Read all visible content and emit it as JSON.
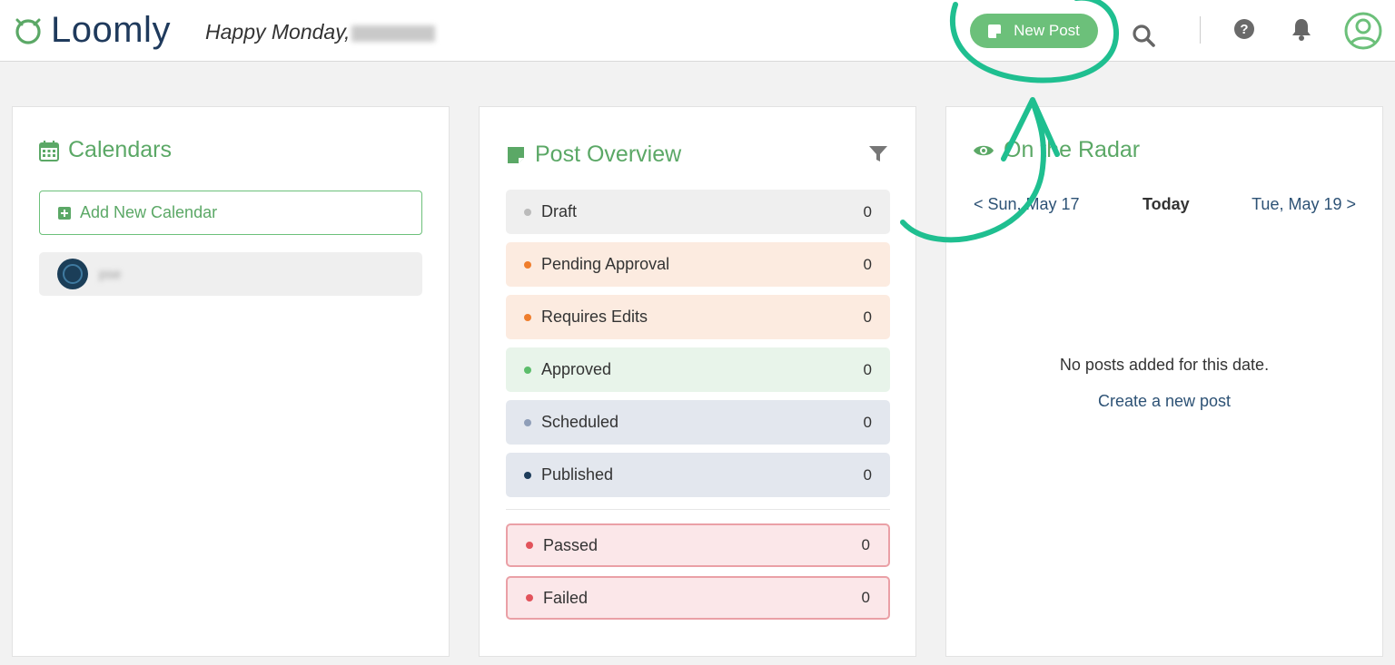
{
  "header": {
    "logo_text": "Loomly",
    "greeting": "Happy Monday",
    "greeting_suffix": ",",
    "new_post_label": "New Post",
    "help_label": "?"
  },
  "calendars": {
    "title": "Calendars",
    "add_label": "Add New Calendar",
    "items": [
      {
        "name": "pse"
      }
    ]
  },
  "post_overview": {
    "title": "Post Overview",
    "statuses": [
      {
        "label": "Draft",
        "count": "0",
        "bg": "#efefef",
        "dot": "#bbbbbb"
      },
      {
        "label": "Pending Approval",
        "count": "0",
        "bg": "#fcebe0",
        "dot": "#ef7d2c"
      },
      {
        "label": "Requires Edits",
        "count": "0",
        "bg": "#fcebe0",
        "dot": "#ef7d2c"
      },
      {
        "label": "Approved",
        "count": "0",
        "bg": "#e8f4ea",
        "dot": "#5cbd6b"
      },
      {
        "label": "Scheduled",
        "count": "0",
        "bg": "#e3e7ee",
        "dot": "#8f9eb8"
      },
      {
        "label": "Published",
        "count": "0",
        "bg": "#e3e7ee",
        "dot": "#1d3c5a"
      },
      {
        "label": "Passed",
        "count": "0",
        "bg": "#fbe7e9",
        "dot": "#e2535b",
        "border": "#eaa0a6"
      },
      {
        "label": "Failed",
        "count": "0",
        "bg": "#fbe7e9",
        "dot": "#e2535b",
        "border": "#eaa0a6"
      }
    ]
  },
  "radar": {
    "title": "On the Radar",
    "prev_label": "< Sun, May 17",
    "today_label": "Today",
    "next_label": "Tue, May 19 >",
    "empty_text": "No posts added for this date.",
    "create_link": "Create a new post"
  },
  "colors": {
    "brand_green": "#6cc07a",
    "title_green": "#5ba866",
    "navy": "#1f3a5c",
    "annotation": "#1fbf90"
  },
  "icons": {
    "logo": "loomly-cat-icon",
    "search": "search-icon",
    "help": "help-icon",
    "bell": "bell-icon",
    "avatar": "user-avatar-icon",
    "calendar": "calendar-icon",
    "note": "note-icon",
    "filter": "filter-icon",
    "eye": "eye-icon"
  }
}
